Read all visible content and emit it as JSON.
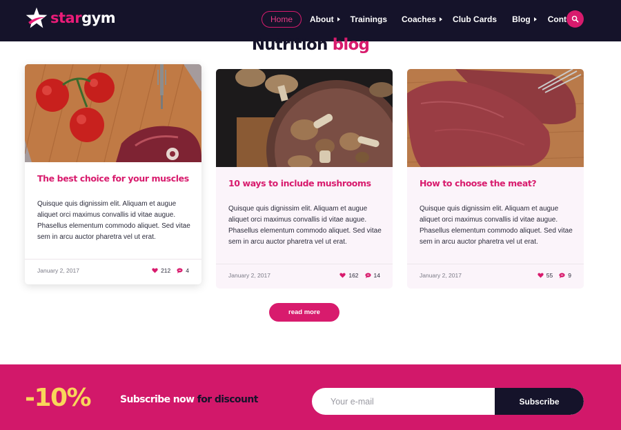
{
  "brand": {
    "logo_part1": "star",
    "logo_part2": "gym"
  },
  "nav": {
    "items": [
      {
        "label": "Home",
        "active": true,
        "has_submenu": false
      },
      {
        "label": "About",
        "active": false,
        "has_submenu": true
      },
      {
        "label": "Trainings",
        "active": false,
        "has_submenu": false
      },
      {
        "label": "Coaches",
        "active": false,
        "has_submenu": true
      },
      {
        "label": "Club Cards",
        "active": false,
        "has_submenu": false
      },
      {
        "label": "Blog",
        "active": false,
        "has_submenu": true
      },
      {
        "label": "Contact",
        "active": false,
        "has_submenu": false
      }
    ],
    "search_icon": "search-icon"
  },
  "section": {
    "title_part1": "Nutrition",
    "title_part2": "blog"
  },
  "posts": [
    {
      "title": "The best choice for your muscles",
      "excerpt": "Quisque quis dignissim elit. Aliquam et augue aliquet orci maximus convallis id vitae augue. Phasellus elementum commodo aliquet. Sed vitae sem in arcu auctor pharetra vel ut erat.",
      "date": "January 2, 2017",
      "likes": "212",
      "comments": "4",
      "image": "tomatoes-and-meat-photo"
    },
    {
      "title": "10 ways to include mushrooms",
      "excerpt": "Quisque quis dignissim elit. Aliquam et augue aliquet orci maximus convallis id vitae augue. Phasellus elementum commodo aliquet. Sed vitae sem in arcu auctor pharetra vel ut erat.",
      "date": "January 2, 2017",
      "likes": "162",
      "comments": "14",
      "image": "mushrooms-photo"
    },
    {
      "title": "How to choose the meat?",
      "excerpt": "Quisque quis dignissim elit. Aliquam et augue aliquet orci maximus convallis id vitae augue. Phasellus elementum commodo aliquet. Sed vitae sem in arcu auctor pharetra vel ut erat.",
      "date": "January 2, 2017",
      "likes": "55",
      "comments": "9",
      "image": "raw-meat-photo"
    }
  ],
  "read_more_label": "read more",
  "subscribe": {
    "discount": "-10%",
    "headline_part1": "Subscribe now",
    "headline_part2": "for discount",
    "email_placeholder": "Your e-mail",
    "button_label": "Subscribe"
  },
  "colors": {
    "navy": "#15132a",
    "accent": "#d81b6d",
    "yellow": "#f9d65a",
    "card_bg": "#fbf4fa"
  }
}
